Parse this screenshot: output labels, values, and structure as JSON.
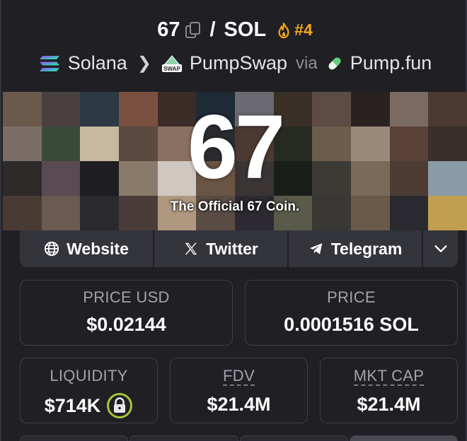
{
  "header": {
    "base_symbol": "67",
    "quote_symbol": "SOL",
    "rank": "#4",
    "chain": "Solana",
    "dex": "PumpSwap",
    "via_label": "via",
    "launchpad": "Pump.fun",
    "swap_badge_text": "SWAP"
  },
  "banner": {
    "big_text": "67",
    "tagline": "The Official 67 Coin."
  },
  "links": {
    "website": "Website",
    "twitter": "Twitter",
    "telegram": "Telegram"
  },
  "stats": {
    "price_usd_label": "PRICE USD",
    "price_usd_value": "$0.02144",
    "price_label": "PRICE",
    "price_value": "0.0001516 SOL",
    "liquidity_label": "LIQUIDITY",
    "liquidity_value": "$714K",
    "fdv_label": "FDV",
    "fdv_value": "$21.4M",
    "mktcap_label": "MKT CAP",
    "mktcap_value": "$21.4M"
  },
  "colors": {
    "background": "#1f1f24",
    "rank_accent": "#f5a623",
    "lock_accent": "#a4c639",
    "button_bg": "#34343b"
  },
  "banner_tiles": [
    "#6b5a4c",
    "#4b4040",
    "#2c3a44",
    "#7a5040",
    "#3c2c28",
    "#1e2a36",
    "#6a6a70",
    "#3a3028",
    "#5c4c44",
    "#2a2220",
    "#7a6a62",
    "#4c3a30",
    "#7a6e66",
    "#3a4a3a",
    "#c8b8a0",
    "#5a4a40",
    "#8a7060",
    "#2a2a30",
    "#4a3a32",
    "#262a22",
    "#6c5c4c",
    "#9a8a7a",
    "#5a4238",
    "#3a2e2a",
    "#2e2a2a",
    "#5a4a52",
    "#1e1e22",
    "#8a7a6a",
    "#d0c8c0",
    "#6a5444",
    "#3a3434",
    "#1a1e1a",
    "#3c3a34",
    "#7a6a5a",
    "#4c3c34",
    "#8a9aa8",
    "#4a3a34",
    "#6a5a50",
    "#2a2a2e",
    "#4a3c3a",
    "#b09880",
    "#5a4c44",
    "#2c2a30",
    "#5a5a4a",
    "#3a3834",
    "#6a5a4a",
    "#2a2a30",
    "#c0a050"
  ]
}
